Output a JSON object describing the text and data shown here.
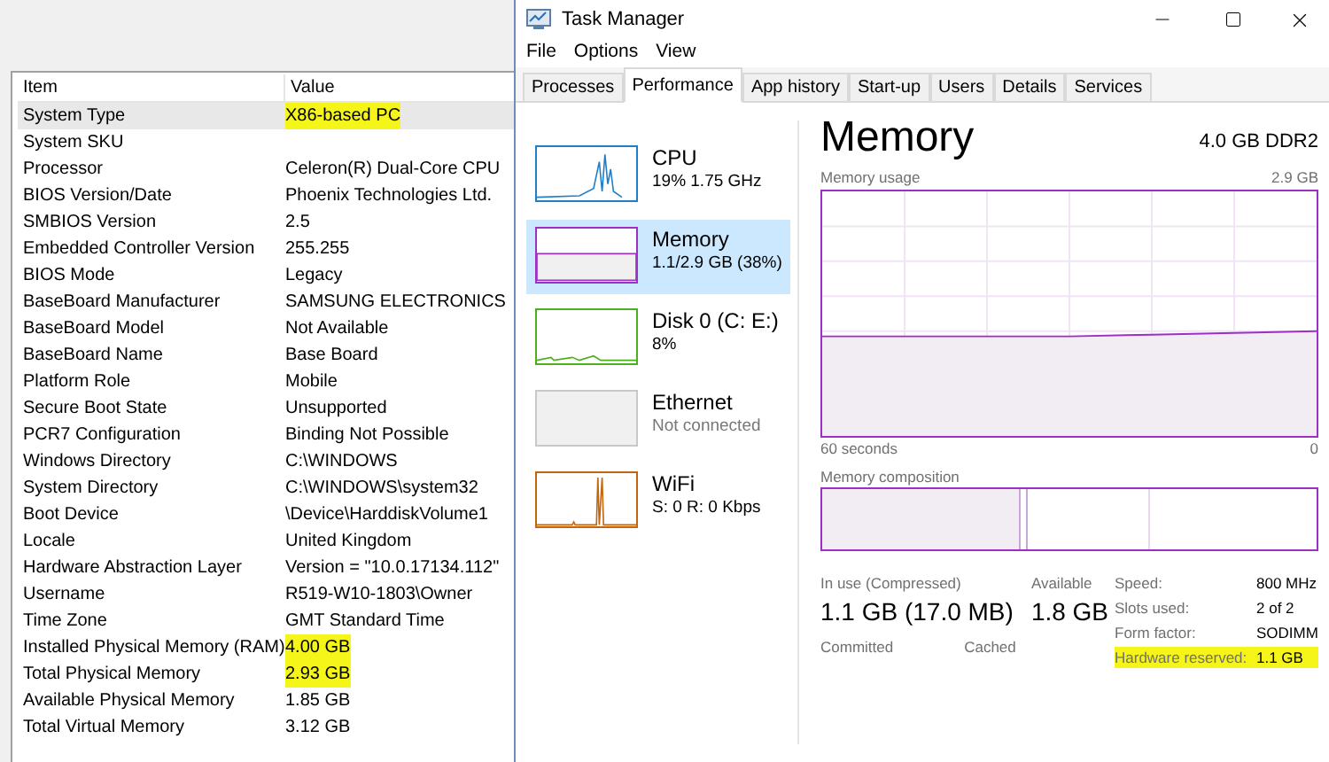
{
  "system_info": {
    "columns": [
      "Item",
      "Value"
    ],
    "rows": [
      {
        "item": "System Type",
        "value": "X86-based PC",
        "highlighted": true,
        "selected": true
      },
      {
        "item": "System SKU",
        "selected": false
      },
      {
        "item": "Processor",
        "value": "Celeron(R) Dual-Core CPU",
        "highlighted": false,
        "selected": false
      },
      {
        "item": "BIOS Version/Date",
        "value": "Phoenix Technologies Ltd.",
        "highlighted": false,
        "selected": false
      },
      {
        "item": "SMBIOS Version",
        "value": "2.5",
        "highlighted": false,
        "selected": false
      },
      {
        "item": "Embedded Controller Version",
        "value": "255.255",
        "highlighted": false,
        "selected": false
      },
      {
        "item": "BIOS Mode",
        "value": "Legacy",
        "highlighted": false,
        "selected": false
      },
      {
        "item": "BaseBoard Manufacturer",
        "value": "SAMSUNG ELECTRONICS",
        "highlighted": false,
        "selected": false
      },
      {
        "item": "BaseBoard Model",
        "value": "Not Available",
        "highlighted": false,
        "selected": false
      },
      {
        "item": "BaseBoard Name",
        "value": "Base Board",
        "highlighted": false,
        "selected": false
      },
      {
        "item": "Platform Role",
        "value": "Mobile",
        "highlighted": false,
        "selected": false
      },
      {
        "item": "Secure Boot State",
        "value": "Unsupported",
        "highlighted": false,
        "selected": false
      },
      {
        "item": "PCR7 Configuration",
        "value": "Binding Not Possible",
        "highlighted": false,
        "selected": false
      },
      {
        "item": "Windows Directory",
        "value": "C:\\WINDOWS",
        "highlighted": false,
        "selected": false
      },
      {
        "item": "System Directory",
        "value": "C:\\WINDOWS\\system32",
        "highlighted": false,
        "selected": false
      },
      {
        "item": "Boot Device",
        "value": "\\Device\\HarddiskVolume1",
        "highlighted": false,
        "selected": false
      },
      {
        "item": "Locale",
        "value": "United Kingdom",
        "highlighted": false,
        "selected": false
      },
      {
        "item": "Hardware Abstraction Layer",
        "value": "Version = \"10.0.17134.112\"",
        "highlighted": false,
        "selected": false
      },
      {
        "item": "Username",
        "value": "R519-W10-1803\\Owner",
        "highlighted": false,
        "selected": false
      },
      {
        "item": "Time Zone",
        "value": "GMT Standard Time",
        "highlighted": false,
        "selected": false
      },
      {
        "item": "Installed Physical Memory (RAM)",
        "value": "4.00 GB",
        "highlighted": true,
        "selected": false
      },
      {
        "item": "Total Physical Memory",
        "value": "2.93 GB",
        "highlighted": true,
        "selected": false
      },
      {
        "item": "Available Physical Memory",
        "value": "1.85 GB",
        "highlighted": false,
        "selected": false
      },
      {
        "item": "Total Virtual Memory",
        "value": "3.12 GB",
        "highlighted": false,
        "selected": false
      }
    ]
  },
  "task_manager": {
    "title": "Task Manager",
    "menu": [
      "File",
      "Options",
      "View"
    ],
    "tabs": [
      {
        "label": "Processes",
        "selected": false
      },
      {
        "label": "Performance",
        "selected": true
      },
      {
        "label": "App history",
        "selected": false
      },
      {
        "label": "Start-up",
        "selected": false
      },
      {
        "label": "Users",
        "selected": false
      },
      {
        "label": "Details",
        "selected": false
      },
      {
        "label": "Services",
        "selected": false
      }
    ],
    "sidebar": [
      {
        "kind": "cpu",
        "name": "CPU",
        "detail": "19%  1.75 GHz",
        "color": "#1e7fc8",
        "selected": false
      },
      {
        "kind": "memory",
        "name": "Memory",
        "detail": "1.1/2.9 GB (38%)",
        "color": "#9b2fc6",
        "selected": true
      },
      {
        "kind": "disk",
        "name": "Disk 0 (C: E:)",
        "detail": "8%",
        "color": "#4caf1e",
        "selected": false
      },
      {
        "kind": "ethernet",
        "name": "Ethernet",
        "detail": "Not connected",
        "color": "#c8c8c8",
        "selected": false
      },
      {
        "kind": "wifi",
        "name": "WiFi",
        "detail": "S: 0 R: 0 Kbps",
        "color": "#c2650f",
        "selected": false
      }
    ],
    "main": {
      "title": "Memory",
      "spec": "4.0 GB DDR2",
      "usage_label": "Memory usage",
      "usage_max": "2.9 GB",
      "time_label": "60 seconds",
      "time_end": "0",
      "composition_label": "Memory composition",
      "stats": [
        {
          "label": "In use (Compressed)",
          "value": "1.1 GB (17.0 MB)"
        },
        {
          "label": "Available",
          "value": "1.8 GB"
        }
      ],
      "stats_2": [
        {
          "label": "Committed"
        },
        {
          "label": "Cached"
        }
      ],
      "specs": [
        {
          "label": "Speed:",
          "value": "800 MHz",
          "highlighted": false
        },
        {
          "label": "Slots used:",
          "value": "2 of 2",
          "highlighted": false
        },
        {
          "label": "Form factor:",
          "value": "SODIMM",
          "highlighted": false
        },
        {
          "label": "Hardware reserved:",
          "value": "1.1 GB",
          "highlighted": true
        }
      ]
    }
  }
}
